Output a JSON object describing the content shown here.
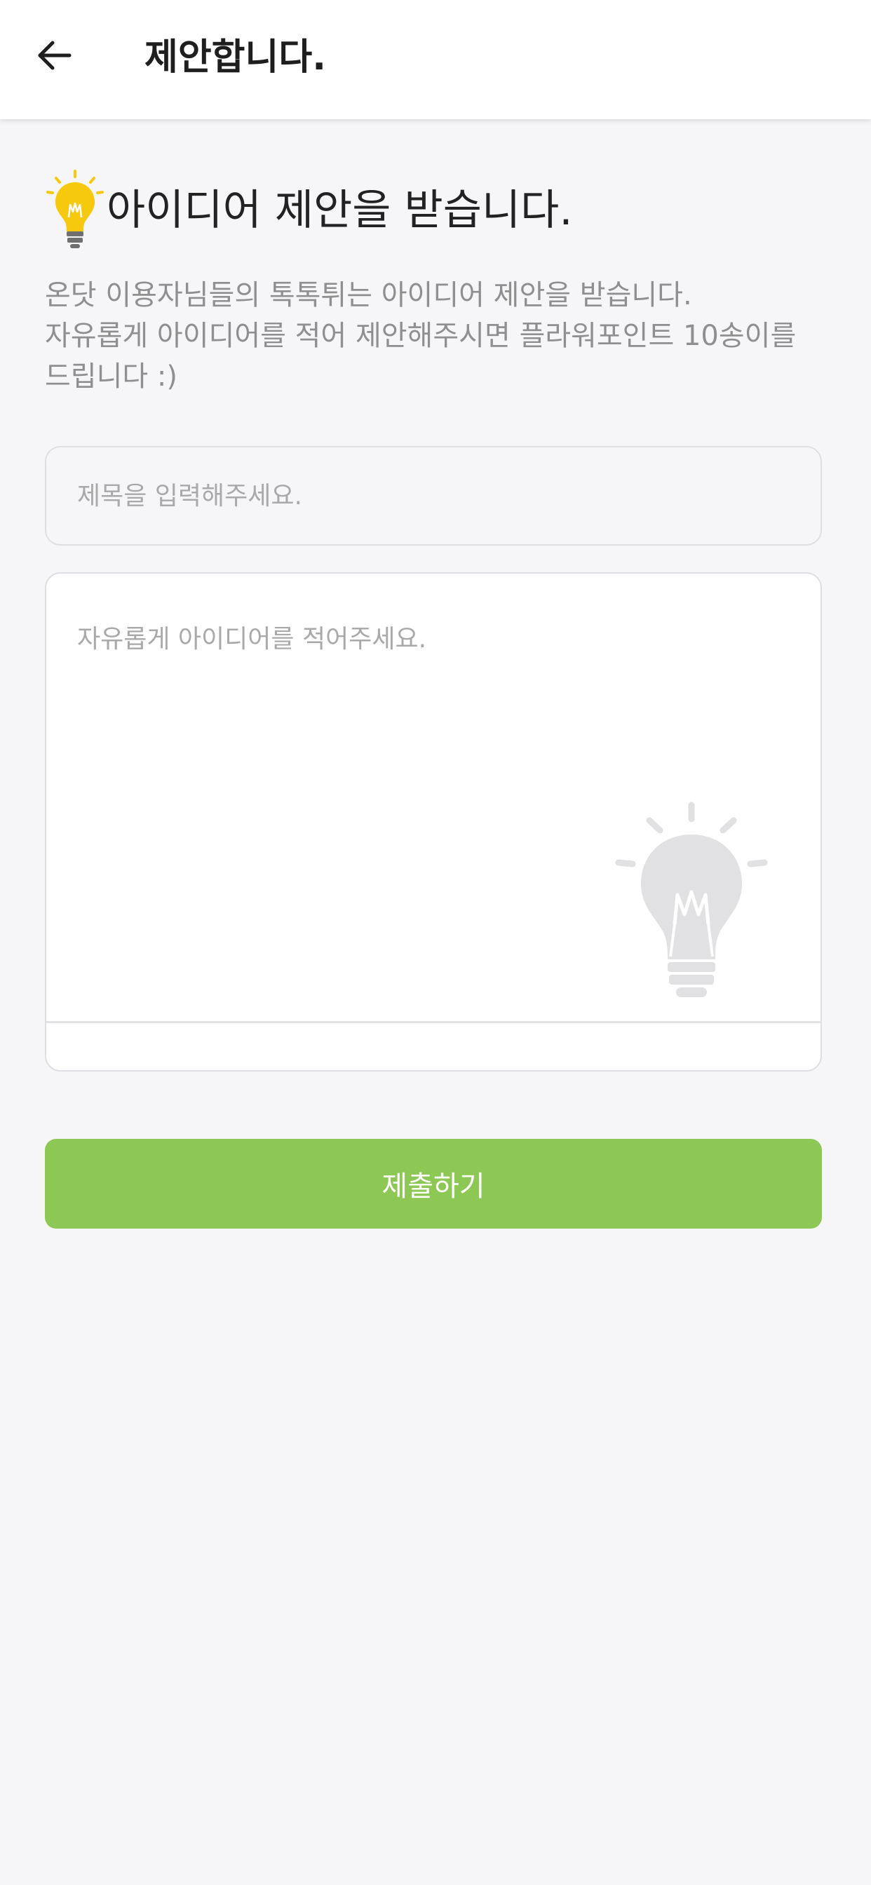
{
  "app_bar": {
    "back_icon": "arrow-left-icon",
    "title": "제안합니다."
  },
  "heading": {
    "icon": "lightbulb-icon",
    "text": "아이디어 제안을 받습니다."
  },
  "description": {
    "lines": [
      "온닷 이용자님들의 톡톡튀는 아이디어 제안을 받습니다.",
      "자유롭게 아이디어를 적어 제안해주시면 플라워포인트 10송이를",
      "드립니다 :)"
    ]
  },
  "form": {
    "title_placeholder": "제목을 입력해주세요.",
    "title_value": "",
    "idea_placeholder": "자유롭게 아이디어를 적어주세요.",
    "idea_value": "",
    "watermark_icon": "lightbulb-watermark-icon"
  },
  "submit": {
    "label": "제출하기"
  },
  "colors": {
    "accent": "#8dc754",
    "bulb_yellow": "#f6c90e",
    "background": "#f6f5f8"
  }
}
